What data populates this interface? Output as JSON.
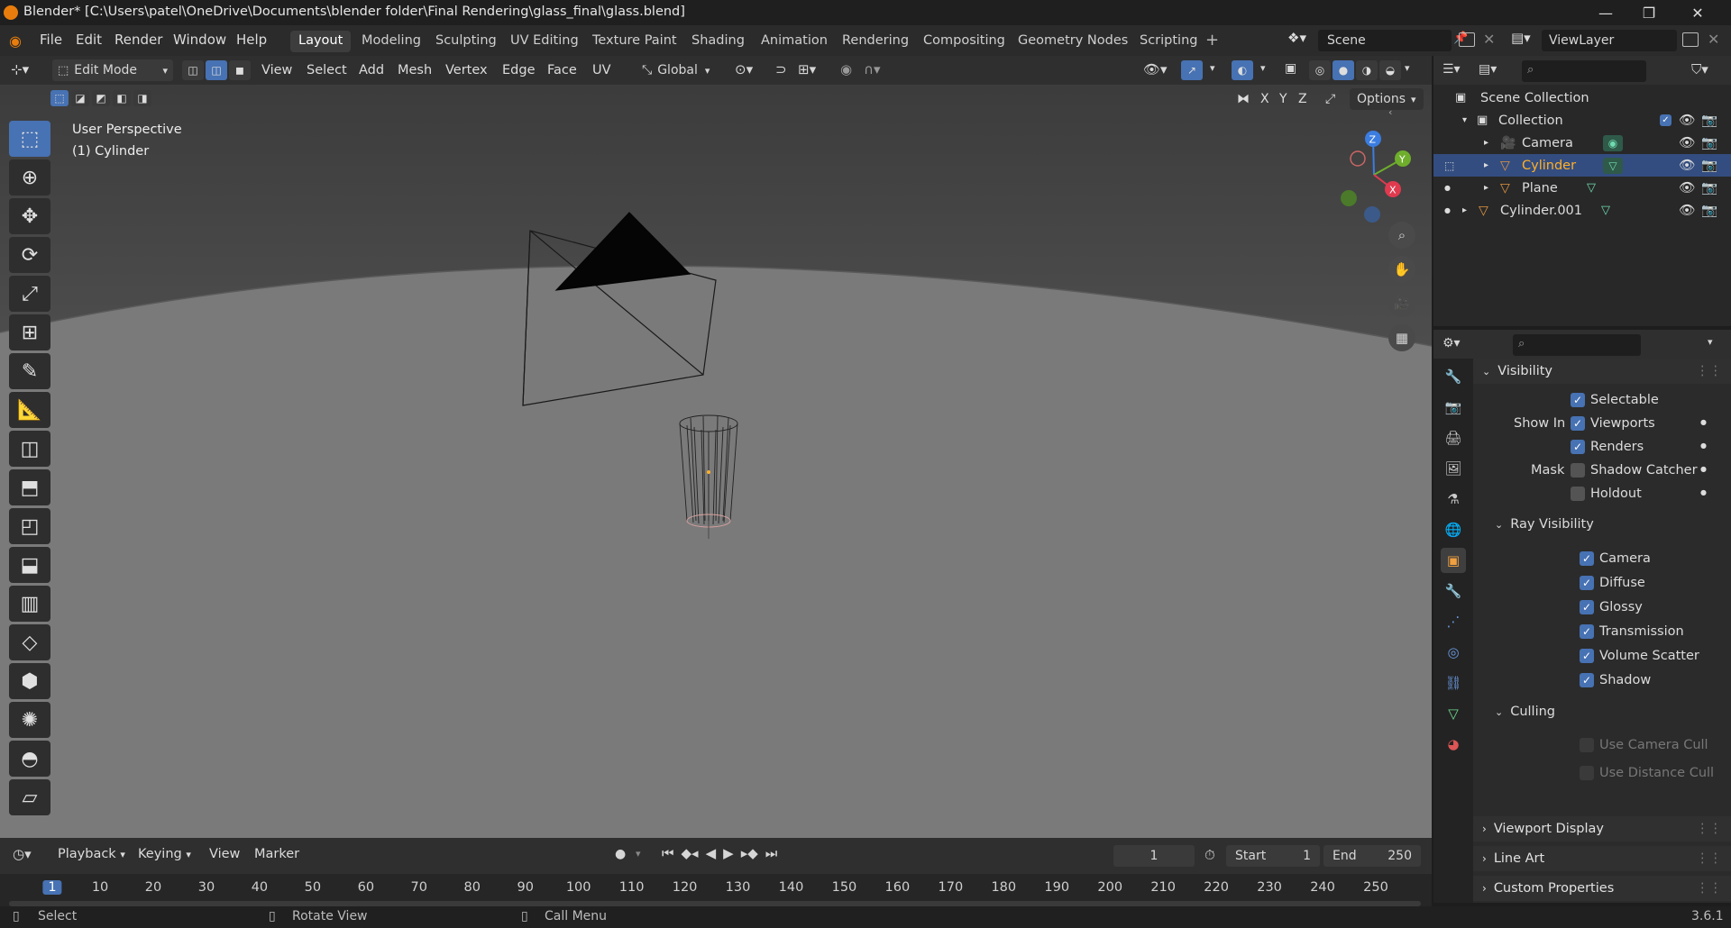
{
  "window": {
    "title": "Blender* [C:\\Users\\patel\\OneDrive\\Documents\\blender folder\\Final Rendering\\glass_final\\glass.blend]",
    "minimize": "—",
    "maximize": "❐",
    "close": "✕"
  },
  "menus": [
    "File",
    "Edit",
    "Render",
    "Window",
    "Help"
  ],
  "workspaces": [
    "Layout",
    "Modeling",
    "Sculpting",
    "UV Editing",
    "Texture Paint",
    "Shading",
    "Animation",
    "Rendering",
    "Compositing",
    "Geometry Nodes",
    "Scripting"
  ],
  "active_workspace": "Layout",
  "scene": "Scene",
  "view_layer": "ViewLayer",
  "viewport_header": {
    "mode": "Edit Mode",
    "menus": [
      "View",
      "Select",
      "Add",
      "Mesh",
      "Vertex",
      "Edge",
      "Face",
      "UV"
    ],
    "transform_orientation": "Global",
    "options_label": "Options",
    "axes": [
      "X",
      "Y",
      "Z"
    ]
  },
  "viewport": {
    "perspective_label": "User Perspective",
    "object_label": "(1) Cylinder"
  },
  "gizmo": {
    "z": "Z",
    "y": "Y",
    "x": "X"
  },
  "outliner": {
    "scene_collection": "Scene Collection",
    "collection": "Collection",
    "items": [
      "Camera",
      "Cylinder",
      "Plane"
    ],
    "extra": "Cylinder.001"
  },
  "properties": {
    "visibility": {
      "header": "Visibility",
      "selectable": "Selectable",
      "show_in_label": "Show In",
      "viewports": "Viewports",
      "renders": "Renders",
      "mask_label": "Mask",
      "shadow_catcher": "Shadow Catcher",
      "holdout": "Holdout"
    },
    "ray_visibility": {
      "header": "Ray Visibility",
      "items": [
        "Camera",
        "Diffuse",
        "Glossy",
        "Transmission",
        "Volume Scatter",
        "Shadow"
      ]
    },
    "culling": {
      "header": "Culling",
      "use_camera_cull": "Use Camera Cull",
      "use_distance_cull": "Use Distance Cull"
    },
    "collapsed_panels": [
      "Viewport Display",
      "Line Art",
      "Custom Properties"
    ]
  },
  "timeline": {
    "menus": [
      "Playback",
      "Keying",
      "View",
      "Marker"
    ],
    "current_frame": "1",
    "start_label": "Start",
    "start": "1",
    "end_label": "End",
    "end": "250",
    "ticks": [
      "1",
      "10",
      "20",
      "30",
      "40",
      "50",
      "60",
      "70",
      "80",
      "90",
      "100",
      "110",
      "120",
      "130",
      "140",
      "150",
      "160",
      "170",
      "180",
      "190",
      "200",
      "210",
      "220",
      "230",
      "240",
      "250"
    ]
  },
  "statusbar": {
    "select": "Select",
    "rotate_view": "Rotate View",
    "call_menu": "Call Menu",
    "version": "3.6.1"
  },
  "colors": {
    "accent_blue": "#4772b3",
    "selected_row": "#334d80",
    "highlight_text": "#ffaf29",
    "viewport_bg": "#6f6f6f"
  }
}
